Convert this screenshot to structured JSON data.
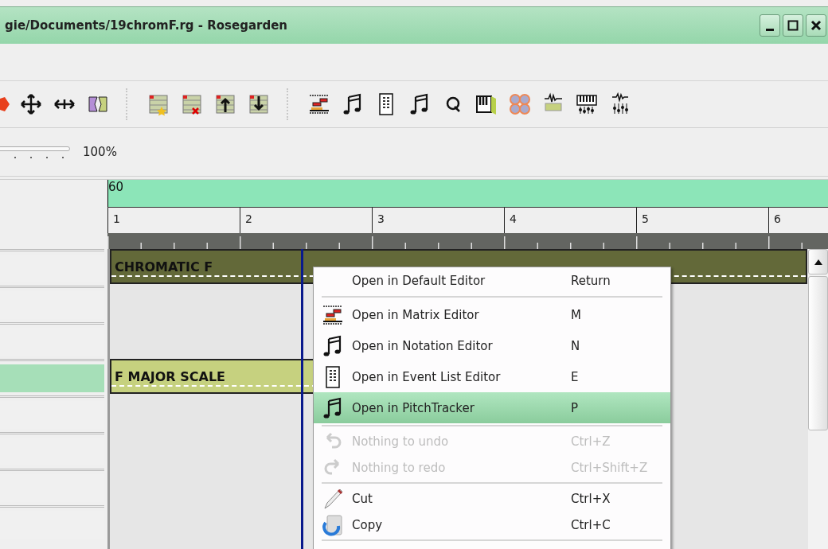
{
  "window": {
    "title": "gie/Documents/19chromF.rg - Rosegarden"
  },
  "zoom": {
    "reading": "100%",
    "level": 1
  },
  "ruler": {
    "tempo": "60",
    "bars": [
      "1",
      "2",
      "3",
      "4",
      "5",
      "6"
    ]
  },
  "tracks": [
    {
      "selected": false,
      "segment": {
        "label": "CHROMATIC F",
        "color": "#636939"
      }
    },
    {
      "selected": false
    },
    {
      "selected": false
    },
    {
      "selected": true,
      "segment": {
        "label": "F MAJOR SCALE",
        "color": "#c6d17f"
      }
    },
    {
      "selected": false
    },
    {
      "selected": false
    },
    {
      "selected": false
    },
    {
      "selected": false
    }
  ],
  "context_menu": [
    {
      "kind": "item",
      "label": "Open in Default Editor",
      "shortcut": "Return",
      "disabled": false,
      "selected": false
    },
    {
      "kind": "separator"
    },
    {
      "kind": "item",
      "label": "Open in Matrix Editor",
      "shortcut": "M",
      "disabled": false,
      "selected": false
    },
    {
      "kind": "item",
      "label": "Open in Notation Editor",
      "shortcut": "N",
      "disabled": false,
      "selected": false
    },
    {
      "kind": "item",
      "label": "Open in Event List Editor",
      "shortcut": "E",
      "disabled": false,
      "selected": false
    },
    {
      "kind": "item",
      "label": "Open in PitchTracker",
      "shortcut": "P",
      "disabled": false,
      "selected": true
    },
    {
      "kind": "separator"
    },
    {
      "kind": "item",
      "label": "Nothing to undo",
      "shortcut": "Ctrl+Z",
      "disabled": true,
      "selected": false
    },
    {
      "kind": "item",
      "label": "Nothing to redo",
      "shortcut": "Ctrl+Shift+Z",
      "disabled": true,
      "selected": false
    },
    {
      "kind": "separator"
    },
    {
      "kind": "item",
      "label": "Cut",
      "shortcut": "Ctrl+X",
      "disabled": false,
      "selected": false
    },
    {
      "kind": "item",
      "label": "Copy",
      "shortcut": "Ctrl+C",
      "disabled": false,
      "selected": false
    },
    {
      "kind": "separator"
    }
  ]
}
